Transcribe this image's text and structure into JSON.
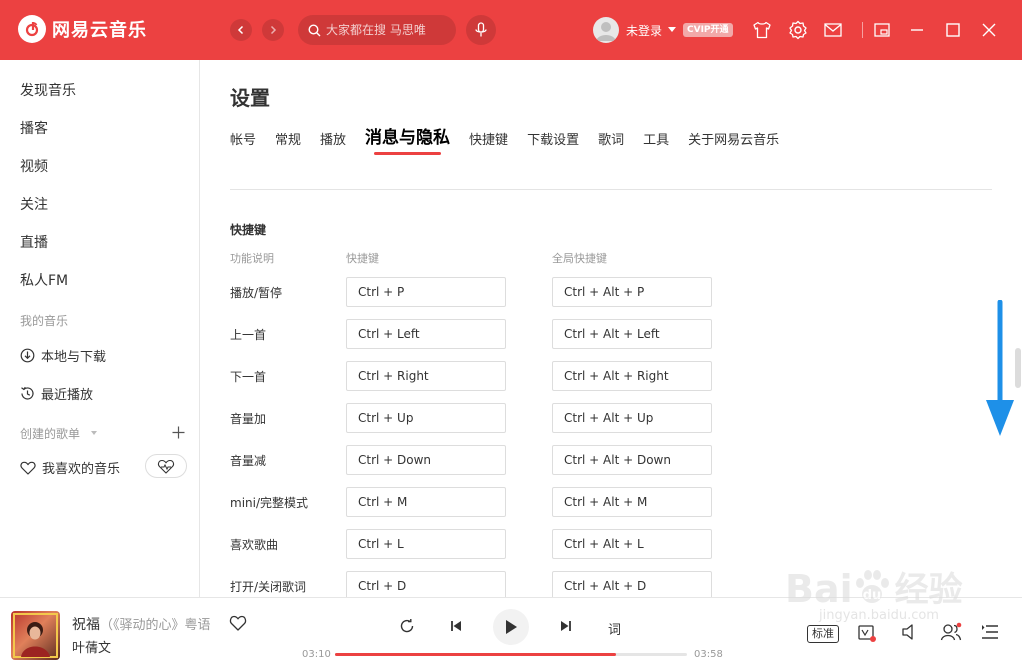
{
  "app": {
    "title": "网易云音乐",
    "accent_color": "#ec4141"
  },
  "header": {
    "back_icon": "chevron-left-icon",
    "forward_icon": "chevron-right-icon",
    "search_placeholder": "大家都在搜 马思唯",
    "mic_icon": "microphone-icon",
    "user_label": "未登录",
    "vip_badge": "CVIP开通",
    "icons": [
      "skin-icon",
      "settings-icon",
      "mail-icon",
      "mini-mode-icon",
      "minimize-icon",
      "maximize-icon",
      "close-icon"
    ]
  },
  "sidebar": {
    "items": [
      {
        "label": "发现音乐"
      },
      {
        "label": "播客"
      },
      {
        "label": "视频"
      },
      {
        "label": "关注"
      },
      {
        "label": "直播"
      },
      {
        "label": "私人FM"
      }
    ],
    "my_music_header": "我的音乐",
    "my_music_items": [
      {
        "label": "本地与下载",
        "icon": "download-icon"
      },
      {
        "label": "最近播放",
        "icon": "history-icon"
      }
    ],
    "playlists_header": "创建的歌单",
    "favorite_playlist": "我喜欢的音乐"
  },
  "settings": {
    "title": "设置",
    "tabs": [
      "帐号",
      "常规",
      "播放",
      "消息与隐私",
      "快捷键",
      "下载设置",
      "歌词",
      "工具",
      "关于网易云音乐"
    ],
    "active_tab": "消息与隐私",
    "shortcut_section_title": "快捷键",
    "columns": {
      "function": "功能说明",
      "shortcut": "快捷键",
      "global_shortcut": "全局快捷键"
    },
    "shortcuts": [
      {
        "function": "播放/暂停",
        "shortcut": "Ctrl + P",
        "global": "Ctrl + Alt + P"
      },
      {
        "function": "上一首",
        "shortcut": "Ctrl + Left",
        "global": "Ctrl + Alt + Left"
      },
      {
        "function": "下一首",
        "shortcut": "Ctrl + Right",
        "global": "Ctrl + Alt + Right"
      },
      {
        "function": "音量加",
        "shortcut": "Ctrl + Up",
        "global": "Ctrl + Alt + Up"
      },
      {
        "function": "音量减",
        "shortcut": "Ctrl + Down",
        "global": "Ctrl + Alt + Down"
      },
      {
        "function": "mini/完整模式",
        "shortcut": "Ctrl + M",
        "global": "Ctrl + Alt + M"
      },
      {
        "function": "喜欢歌曲",
        "shortcut": "Ctrl + L",
        "global": "Ctrl + Alt + L"
      },
      {
        "function": "打开/关闭歌词",
        "shortcut": "Ctrl + D",
        "global": "Ctrl + Alt + D"
      }
    ]
  },
  "player": {
    "song_title": "祝福",
    "song_subtitle": "（《驿动的心》粤语",
    "artist": "叶蒨文",
    "current_time": "03:10",
    "total_time": "03:58",
    "progress": 0.797,
    "lyric_button": "词",
    "quality_label": "标准",
    "icons": [
      "repeat-icon",
      "previous-icon",
      "play-icon",
      "next-icon",
      "sound-effect-icon",
      "volume-icon",
      "listen-together-icon",
      "playlist-icon"
    ]
  },
  "watermark": {
    "brand": "Bai",
    "brand_du": "du",
    "cn": "经验",
    "url": "jingyan.baidu.com"
  }
}
